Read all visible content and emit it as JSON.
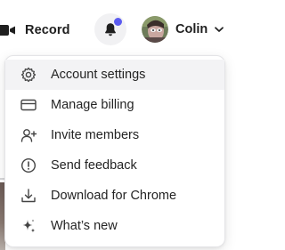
{
  "header": {
    "record_label": "Record",
    "user_name": "Colin",
    "notification_dot_color": "#5b5bf0",
    "bell_icon": "bell-icon",
    "record_icon": "video-camera-icon"
  },
  "menu": {
    "items": [
      {
        "label": "Account settings",
        "icon": "gear-icon",
        "active": true
      },
      {
        "label": "Manage billing",
        "icon": "credit-card-icon",
        "active": false
      },
      {
        "label": "Invite members",
        "icon": "user-plus-icon",
        "active": false
      },
      {
        "label": "Send feedback",
        "icon": "alert-circle-icon",
        "active": false
      },
      {
        "label": "Download for Chrome",
        "icon": "download-icon",
        "active": false
      },
      {
        "label": "What’s new",
        "icon": "sparkle-icon",
        "active": false
      }
    ]
  }
}
